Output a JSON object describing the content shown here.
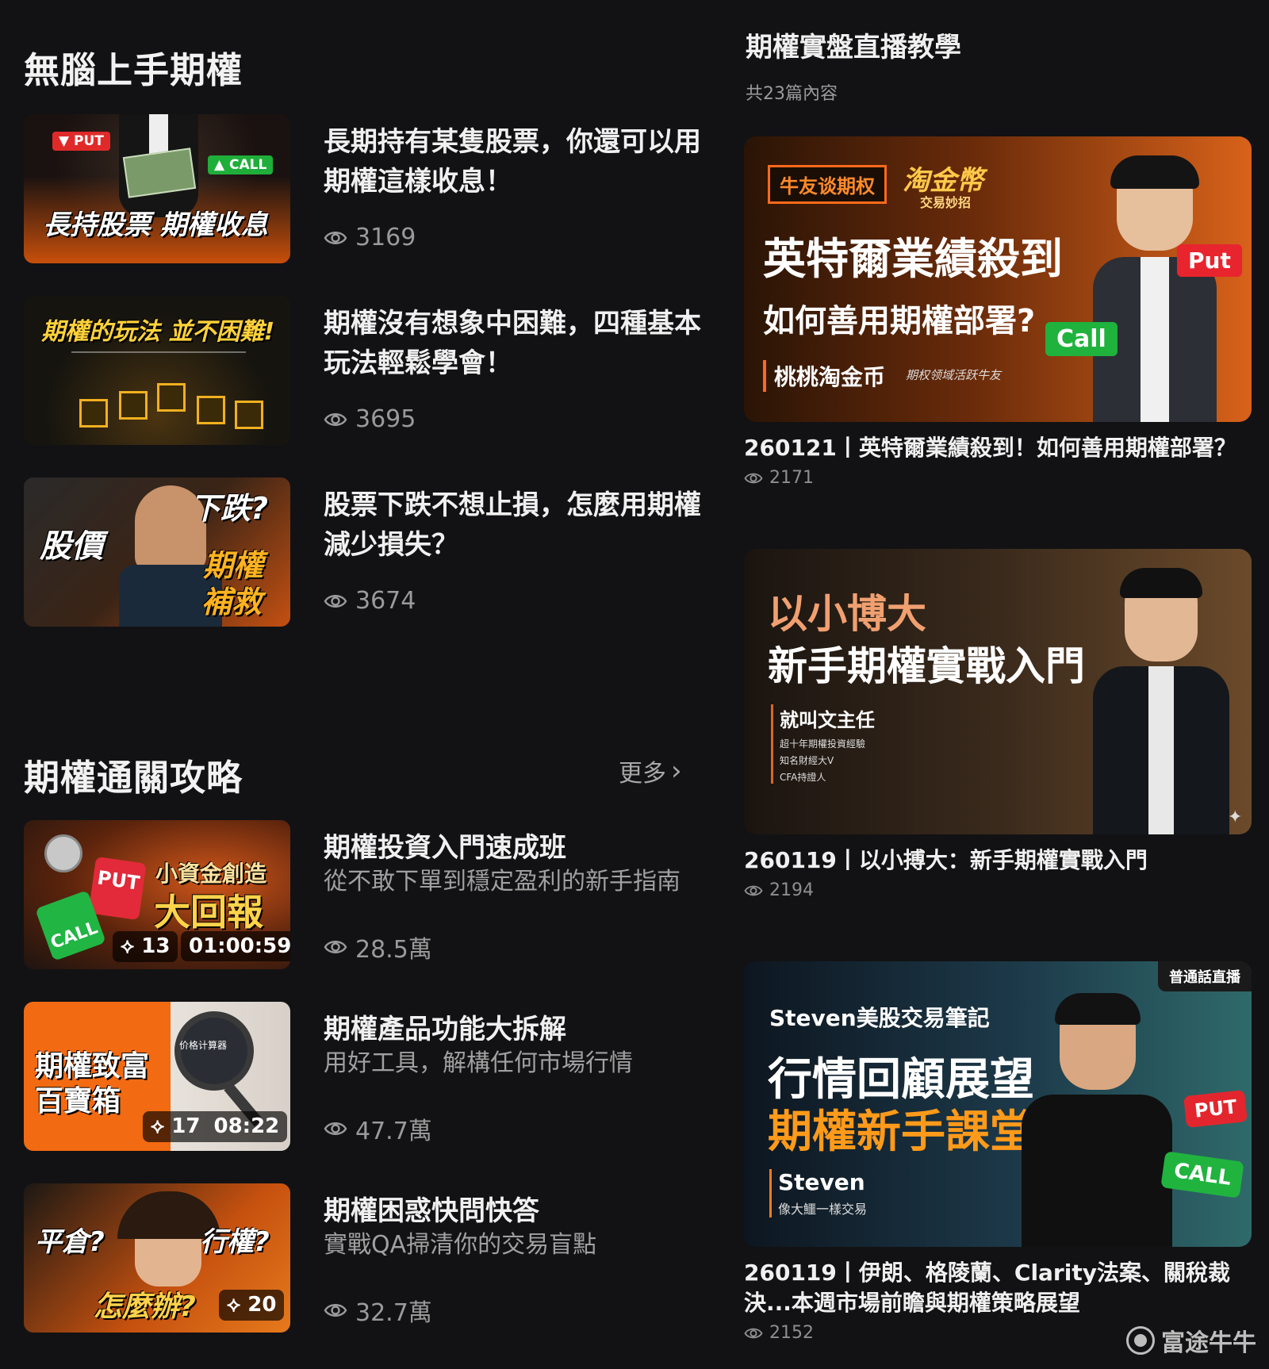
{
  "left": {
    "section1": {
      "title": "無腦上手期權",
      "items": [
        {
          "title": "長期持有某隻股票，你還可以用期權這樣收息！",
          "views": "3169",
          "thumb": {
            "caption": "長持股票 期權收息",
            "put": "▼ PUT",
            "call": "▲ CALL"
          }
        },
        {
          "title": "期權沒有想象中困難，四種基本玩法輕鬆學會！",
          "views": "3695",
          "thumb": {
            "caption": "期權的玩法 並不困難!"
          }
        },
        {
          "title": "股票下跌不想止損，怎麼用期權減少損失？",
          "views": "3674",
          "thumb": {
            "text1": "股價",
            "text2": "下跌?",
            "text3": "期權",
            "text4": "補救"
          }
        }
      ]
    },
    "section2": {
      "title": "期權通關攻略",
      "more": "更多",
      "items": [
        {
          "title": "期權投資入門速成班",
          "subtitle": "從不敢下單到穩定盈利的新手指南",
          "views": "28.5萬",
          "thumb": {
            "line1": "小資金創造",
            "line2": "大回報",
            "count": "13",
            "duration": "01:00:59",
            "put": "PUT",
            "call": "CALL"
          }
        },
        {
          "title": "期權產品功能大拆解",
          "subtitle": "用好工具，解構任何市場行情",
          "views": "47.7萬",
          "thumb": {
            "line1": "期權致富",
            "line2": "百寶箱",
            "count": "17",
            "duration": "08:22",
            "calc": "价格计算器"
          }
        },
        {
          "title": "期權困惑快問快答",
          "subtitle": "實戰QA掃清你的交易盲點",
          "views": "32.7萬",
          "thumb": {
            "q1": "平倉?",
            "q2": "行權?",
            "q3": "怎麼辦?",
            "count": "20"
          }
        }
      ]
    }
  },
  "right": {
    "title": "期權實盤直播教學",
    "subtitle": "共23篇內容",
    "items": [
      {
        "title": "260121丨英特爾業績殺到！如何善用期權部署？",
        "views": "2171",
        "thumb": {
          "tag": "牛友谈期权",
          "logo1": "淘金幣",
          "logo2": "交易妙招",
          "headline": "英特爾業績殺到",
          "sub": "如何善用期權部署?",
          "host": "桃桃淘金币",
          "host_desc": "期权领域活跃牛友",
          "put": "Put",
          "call": "Call"
        }
      },
      {
        "title": "260119丨以小搏大：新手期權實戰入門",
        "views": "2194",
        "thumb": {
          "headline1": "以小博大",
          "headline2": "新手期權實戰入門",
          "host": "就叫文主任",
          "desc1": "超十年期權投資經驗",
          "desc2": "知名財經大V",
          "desc3": "CFA持證人"
        }
      },
      {
        "title": "260119丨伊朗、格陵蘭、Clarity法案、關稅裁決...本週市場前瞻與期權策略展望",
        "views": "2152",
        "thumb": {
          "corner": "普通話直播",
          "brand": "Steven美股交易筆記",
          "headline1": "行情回顧展望",
          "headline2": "期權新手課堂",
          "host": "Steven",
          "host_desc": "像大鱷一樣交易",
          "put": "PUT",
          "call": "CALL"
        }
      }
    ]
  },
  "watermark": "富途牛牛"
}
